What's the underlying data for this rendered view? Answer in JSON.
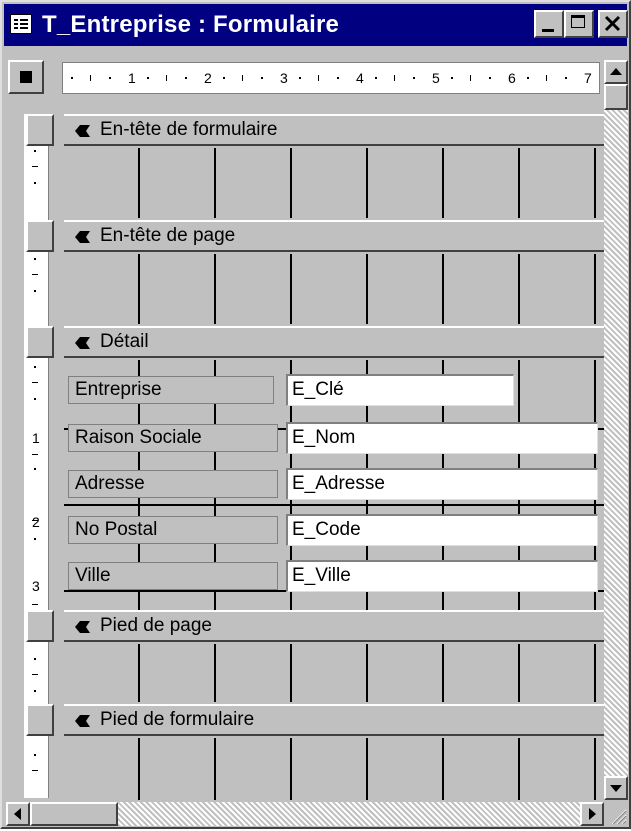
{
  "window": {
    "title": "T_Entreprise : Formulaire"
  },
  "ruler": {
    "horizontal_numbers": [
      "1",
      "2",
      "3",
      "4",
      "5",
      "6",
      "7"
    ],
    "vertical_numbers": [
      "1",
      "2",
      "3"
    ]
  },
  "sections": {
    "form_header": "En-tête de formulaire",
    "page_header": "En-tête de page",
    "detail": "Détail",
    "page_footer": "Pied de page",
    "form_footer": "Pied de formulaire"
  },
  "fields": [
    {
      "label": "Entreprise",
      "control": "E_Clé"
    },
    {
      "label": "Raison Sociale",
      "control": "E_Nom"
    },
    {
      "label": "Adresse",
      "control": "E_Adresse"
    },
    {
      "label": "No Postal",
      "control": "E_Code"
    },
    {
      "label": "Ville",
      "control": "E_Ville"
    }
  ],
  "colors": {
    "title_bar": "#000080",
    "face": "#c0c0c0"
  }
}
